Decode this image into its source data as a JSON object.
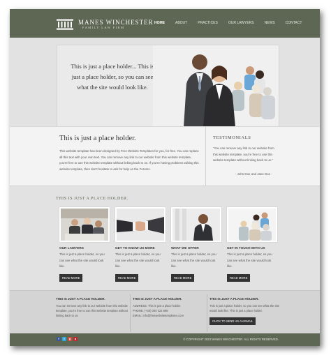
{
  "brand": {
    "name": "MANES WINCHESTER",
    "tagline": "FAMILY LAW FIRM",
    "icon": "columns-logo-icon"
  },
  "nav": [
    {
      "label": "HOME",
      "active": true
    },
    {
      "label": "ABOUT",
      "active": false
    },
    {
      "label": "PRACTICES",
      "active": false
    },
    {
      "label": "OUR LAWYERS",
      "active": false
    },
    {
      "label": "NEWS",
      "active": false
    },
    {
      "label": "CONTACT",
      "active": false
    }
  ],
  "hero": {
    "text": "This is just a place holder... This is just a place holder, so you can see what the site would look like."
  },
  "intro": {
    "title": "This is just a place holder.",
    "body": "This website template has been designed by Free Website Templates for you, for free. You can replace all this text with your own text. You can remove any link to our website from this website template, you're free to use this website template without linking back to us. If you're having problems editing this website template, then don't hesitate to ask for help on the Forums."
  },
  "testimonials": {
    "title": "TESTIMONIALS",
    "quote": "\"You can remove any link to our website from this website template, you're free to use this website template without linking back to us.\"",
    "author": "- John Doe and Jane Doe -"
  },
  "services": {
    "title": "THIS IS JUST A PLACE HOLDER.",
    "cards": [
      {
        "title": "OUR LAWYERS",
        "text": "This is just a place holder, so you can see what the site would look like.",
        "button": "READ MORE"
      },
      {
        "title": "GET TO KNOW US MORE",
        "text": "This is just a place holder, so you can see what the site would look like.",
        "button": "READ MORE"
      },
      {
        "title": "WHAT WE OFFER",
        "text": "This is just a place holder, so you can see what the site would look like.",
        "button": "READ MORE"
      },
      {
        "title": "GET IN TOUCH WITH US",
        "text": "This is just a place holder, so you can see what the site would look like.",
        "button": "READ MORE"
      }
    ]
  },
  "footer": {
    "col1": {
      "title": "THIS IS JUST A PLACE HOLDER.",
      "text": "You can remove any link to our website from this website template, you're free to use this website template without linking back to us."
    },
    "col2": {
      "title": "THIS IS JUST A PLACE HOLDER.",
      "address": "ADDRESS: This is just a place holder.",
      "phone": "PHONE: (+20) 000 222 999",
      "email": "EMAIL: info@freewebsitetemplates.com"
    },
    "col3": {
      "title": "THIS IS JUST A PLACE HOLDER.",
      "text": "This is just a place holder, so you can see what the site would look like. This is just a place holder.",
      "button": "CLICK TO SEND US AN EMAIL"
    }
  },
  "bottom": {
    "socials": [
      "facebook-icon",
      "twitter-icon",
      "googleplus-icon",
      "pinterest-icon"
    ],
    "copyright": "© COPYRIGHT 2023 MANES WINCHESTER. ALL RIGHTS RESERVED."
  },
  "colors": {
    "brand_green": "#5e6654",
    "page_bg": "#e2e2e2",
    "button_dark": "#333333"
  }
}
